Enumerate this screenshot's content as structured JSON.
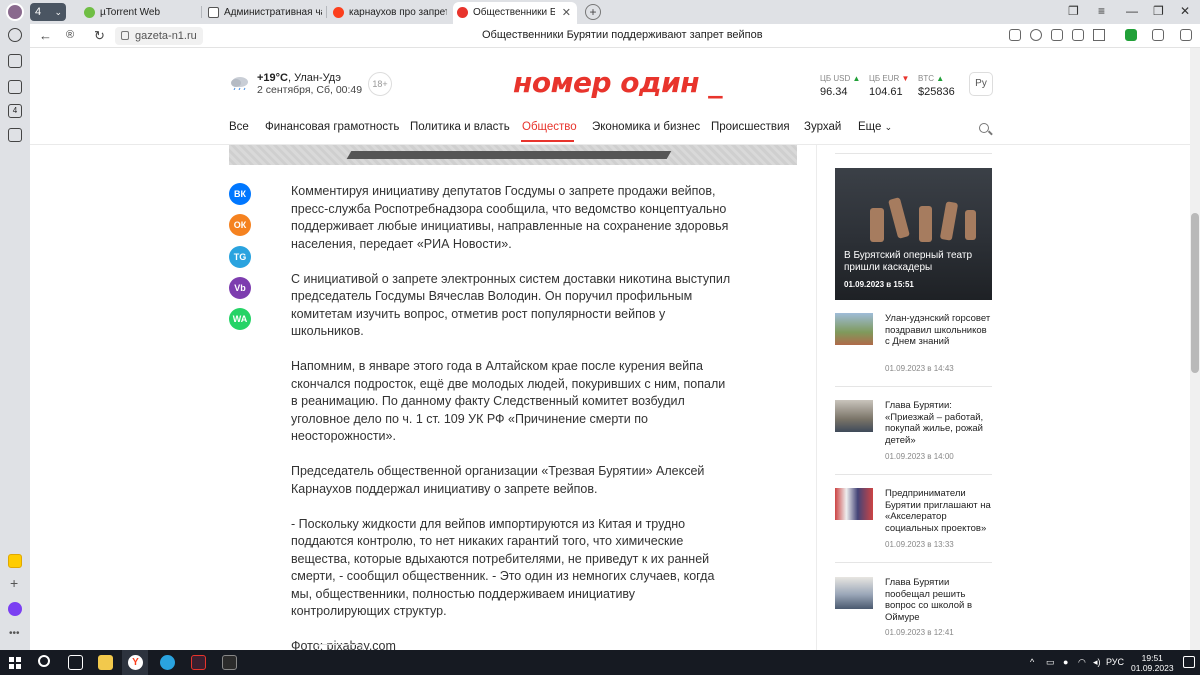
{
  "browser": {
    "tab_count": "4",
    "tabs": [
      {
        "label": "µTorrent Web",
        "icon_color": "#6fbe44"
      },
      {
        "label": "Административная часть",
        "icon_color": "#ffffff"
      },
      {
        "label": "карнаухов про запрет вей",
        "icon_color": "#ff0000"
      },
      {
        "label": "Общественники Бурятии",
        "icon_color": "#e8342c"
      }
    ],
    "url": "gazeta-n1.ru",
    "page_title": "Общественники Бурятии поддерживают запрет вейпов"
  },
  "header": {
    "temperature": "+19°C",
    "city": ", Улан-Удэ",
    "date": "2 сентября, Сб, 00:49",
    "age_rating": "18+",
    "logo": "номер один _",
    "rates": [
      {
        "label": "ЦБ USD",
        "value": "96.34",
        "trend": "up"
      },
      {
        "label": "ЦБ EUR",
        "value": "104.61",
        "trend": "down"
      },
      {
        "label": "BTC",
        "value": "$25836",
        "trend": "up"
      }
    ],
    "lang": "Ру"
  },
  "nav": {
    "items": [
      "Все",
      "Финансовая грамотность",
      "Политика и власть",
      "Общество",
      "Экономика и бизнес",
      "Происшествия",
      "Зурхай",
      "Еще"
    ],
    "active": "Общество"
  },
  "share": [
    "ВК",
    "ОК",
    "TG",
    "Vb",
    "WA"
  ],
  "article": {
    "paragraphs": [
      "Комментируя инициативу депутатов Госдумы о запрете продажи вейпов, пресс-служба Роспотребнадзора сообщила, что ведомство концептуально поддерживает любые инициативы, направленные на сохранение здоровья населения, передает «РИА Новости».",
      "С инициативой о запрете электронных систем доставки никотина выступил председатель Госдумы Вячеслав Володин. Он поручил профильным комитетам изучить вопрос, отметив рост популярности вейпов у школьников.",
      "Напомним, в январе этого года в Алтайском крае после курения вейпа скончался подросток, ещё две молодых людей, покуривших с ним, попали в реанимацию. По данному факту Следственный комитет возбудил уголовное дело по ч. 1 ст. 109 УК РФ «Причинение смерти по неосторожности».",
      "Председатель общественной организации «Трезвая Бурятии» Алексей Карнаухов поддержал инициативу о запрете вейпов.",
      "- Поскольку жидкости для вейпов импортируются из Китая и трудно поддаются контролю, то нет никаких гарантий того, что химические вещества, которые вдыхаются потребителями, не приведут к их ранней смерти, - сообщил общественник. - Это один из немногих случаев, когда мы, общественники, полностью поддерживаем инициативу контролирующих структур.",
      "Фото: pixabay.com"
    ]
  },
  "sidebar": {
    "featured": {
      "title": "В Бурятский оперный театр пришли каскадеры",
      "date": "01.09.2023 в 15:51"
    },
    "news": [
      {
        "title": "Улан-удэнский горсовет поздравил школьников с Днем знаний",
        "date": "01.09.2023 в 14:43"
      },
      {
        "title": "Глава Бурятии: «Приезжай – работай, покупай жилье, рожай детей»",
        "date": "01.09.2023 в 14:00"
      },
      {
        "title": "Предприниматели Бурятии приглашают на «Акселератор социальных проектов»",
        "date": "01.09.2023 в 13:33"
      },
      {
        "title": "Глава Бурятии пообещал решить вопрос со школой в Оймуре",
        "date": "01.09.2023 в 12:41"
      }
    ]
  },
  "taskbar": {
    "lang": "РУС",
    "time": "19:51",
    "date": "01.09.2023"
  }
}
